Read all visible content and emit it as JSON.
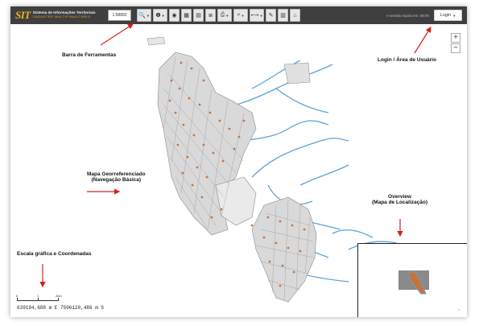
{
  "toolbar": {
    "logo_mark": "SIT",
    "logo_line1": "Sistema de Informações Territoriais",
    "logo_line2": "CADASTRO MULTIFINALITÁRIO",
    "scale_value": "1:58882",
    "session_text": "A sessão expira em: 59:00",
    "login_label": "Login",
    "tools": [
      {
        "icon": "magnifier-zoom-icon",
        "glyph": "🔍",
        "caret": true
      },
      {
        "icon": "info-icon",
        "glyph": "❶",
        "caret": true
      },
      {
        "icon": "eye-icon",
        "glyph": "◉",
        "caret": false
      },
      {
        "icon": "grid-icon",
        "glyph": "▦",
        "caret": false
      },
      {
        "icon": "document-icon",
        "glyph": "▤",
        "caret": false
      },
      {
        "icon": "list-icon",
        "glyph": "≣",
        "caret": false
      },
      {
        "icon": "print-icon",
        "glyph": "⎙",
        "caret": true
      },
      {
        "icon": "search-icon",
        "glyph": "⌕",
        "caret": true
      },
      {
        "icon": "measure-icon",
        "glyph": "⟷",
        "caret": true
      },
      {
        "icon": "pencil-icon",
        "glyph": "✎",
        "caret": false
      },
      {
        "icon": "table-icon",
        "glyph": "▥",
        "caret": false
      },
      {
        "icon": "home-icon",
        "glyph": "⌂",
        "caret": false
      }
    ]
  },
  "zoom": {
    "in": "+",
    "out": "−"
  },
  "annotations": {
    "toolbar": "Barra de Ferramentas",
    "login": "Login / Área de Usuário",
    "map_line1": "Mapa Georreferenciado",
    "map_line2": "(Navegação Básica)",
    "overview_line1": "Overview",
    "overview_line2": "(Mapa de Localização)",
    "scale": "Escala gráfica e Coordenadas"
  },
  "scalebar": {
    "zero": "0",
    "one": "1",
    "two": "2km"
  },
  "coordinates": "639194,688 m E   7506120,486 m S",
  "attribution": "^",
  "colors": {
    "toolbar_bg": "#3f3f3f",
    "logo_accent": "#f0b323",
    "river": "#5fa3d6",
    "parcel": "#c8733a",
    "arrow": "#d42020"
  }
}
